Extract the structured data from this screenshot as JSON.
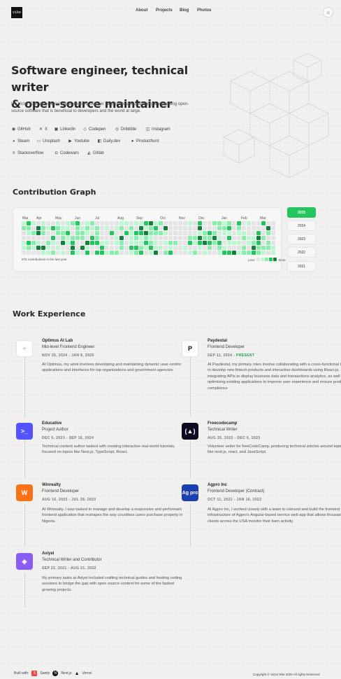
{
  "header": {
    "logo_text": "vike",
    "nav": [
      {
        "label": "About"
      },
      {
        "label": "Projects"
      },
      {
        "label": "Blog"
      },
      {
        "label": "Photos"
      }
    ],
    "theme_icon": "sun-icon"
  },
  "hero": {
    "title_line1": "Software engineer, technical writer",
    "title_line2": "& open-source maintainer",
    "intro": "I'm Victor Eke, an experienced frontend developer passionate about learning and building open-source software that is beneficial to developers and the world at large.",
    "socials": [
      {
        "label": "GitHub",
        "icon": "github-icon"
      },
      {
        "label": "X",
        "icon": "x-icon"
      },
      {
        "label": "Linkedin",
        "icon": "linkedin-icon"
      },
      {
        "label": "Codepen",
        "icon": "codepen-icon"
      },
      {
        "label": "Dribbble",
        "icon": "dribbble-icon"
      },
      {
        "label": "Instagram",
        "icon": "instagram-icon"
      },
      {
        "label": "Steam",
        "icon": "steam-icon"
      },
      {
        "label": "Unsplash",
        "icon": "unsplash-icon"
      },
      {
        "label": "Youtube",
        "icon": "youtube-icon"
      },
      {
        "label": "Daily.dev",
        "icon": "dailydev-icon"
      },
      {
        "label": "Producthunt",
        "icon": "producthunt-icon"
      },
      {
        "label": "Stackoverflow",
        "icon": "stackoverflow-icon"
      },
      {
        "label": "Codewars",
        "icon": "codewars-icon"
      },
      {
        "label": "Gitlab",
        "icon": "gitlab-icon"
      }
    ]
  },
  "contribution": {
    "title": "Contribution Graph",
    "months": [
      "Mar",
      "Apr",
      "May",
      "Jun",
      "Jul",
      "Aug",
      "Sep",
      "Oct",
      "Nov",
      "Dec",
      "Jan",
      "Feb",
      "Mar"
    ],
    "summary": "875 contributions in the last year",
    "legend_less": "Less",
    "legend_more": "More",
    "colors": [
      "#e4e4e7",
      "#bbf7d0",
      "#86efac",
      "#22c55e",
      "#15803d"
    ],
    "years": [
      {
        "label": "2025",
        "active": true
      },
      {
        "label": "2024",
        "active": false
      },
      {
        "label": "2023",
        "active": false
      },
      {
        "label": "2022",
        "active": false
      },
      {
        "label": "2021",
        "active": false
      }
    ]
  },
  "experience": {
    "title": "Work Experience",
    "jobs": [
      {
        "company": "Optimus AI Lab",
        "role": "Mid-level Frontend Engineer",
        "start": "NOV 25, 2024",
        "end": "JAN 8, 2025",
        "present": false,
        "desc": "At Optimus, my work involves developing and maintaining dynamic user-centric applications and interfaces for top organizations and government agencies",
        "logo_icon": "optimus-logo-icon",
        "logo_text": "✦",
        "logo_bg": "#ffffff",
        "logo_fg": "#d4d4d8"
      },
      {
        "company": "Paydestal",
        "role": "Frontend Developer",
        "start": "SEP 11, 2024",
        "end": "PRESENT",
        "present": true,
        "desc": "At Paydestal, my primary roles involve collaborating with a cross-functional team to develop new fintech products and interactive dashboards using React.js, integrating APIs to display business data and transactions analytics, as well as optimizing existing applications to improve user experience and ensure product compliance",
        "logo_icon": "paydestal-logo-icon",
        "logo_text": "P",
        "logo_bg": "#ffffff",
        "logo_fg": "#111111"
      },
      {
        "company": "Educative",
        "role": "Project Author",
        "start": "DEC 5, 2023",
        "end": "SEP 16, 2024",
        "present": false,
        "desc": "Technical content author tasked with creating interactive real-world tutorials, focused on topics like Next.js, TypeScript, React.",
        "logo_icon": "educative-logo-icon",
        "logo_text": ">_",
        "logo_bg": "#5553ff",
        "logo_fg": "#ffffff"
      },
      {
        "company": "Freecodecamp",
        "role": "Technical Writer",
        "start": "AUG 25, 2022",
        "end": "DEC 6, 2023",
        "present": false,
        "desc": "Volunteer writer for freeCodeCamp, producing technical articles around topics like next.js, react, and JavaScript.",
        "logo_icon": "freecodecamp-logo-icon",
        "logo_text": "(▲)",
        "logo_bg": "#0a0a23",
        "logo_fg": "#ffffff"
      },
      {
        "company": "Winrealty",
        "role": "Frontend Developer",
        "start": "AUG 16, 2022",
        "end": "JUL 28, 2023",
        "present": false,
        "desc": "At Winrealty, I was tasked to manage and develop a responsive and performant frontend application that reshapes the way countless users purchase property in Nigeria.",
        "logo_icon": "winrealty-logo-icon",
        "logo_text": "W",
        "logo_bg": "#f97316",
        "logo_fg": "#ffffff"
      },
      {
        "company": "Agpro Inc",
        "role": "Frontend Developer (Contract)",
        "start": "OCT 11, 2022",
        "end": "JAN 16, 2023",
        "present": false,
        "desc": "At Agpro Inc, I worked closely with a team to rebrand and build the frontend infrastructure of Agpro's Angular-based service web app that allows thousands of clients across the USA monitor their barn activity.",
        "logo_icon": "agpro-logo-icon",
        "logo_text": "Ag pro",
        "logo_bg": "#1e40af",
        "logo_fg": "#ffffff"
      },
      {
        "company": "Aviyel",
        "role": "Technical Writer and Contributor",
        "start": "SEP 22, 2021",
        "end": "AUG 21, 2022",
        "present": false,
        "desc": "My primary tasks at Aviyel included crafting technical guides and hosting coding sessions to bridge the gap with open source content for some of the fastest growing projects.",
        "logo_icon": "aviyel-logo-icon",
        "logo_text": "◈",
        "logo_bg": "#8b5cf6",
        "logo_fg": "#ffffff"
      }
    ]
  },
  "footer": {
    "built_with": "Built with:",
    "tools": [
      {
        "label": "Sanity",
        "icon": "sanity-icon"
      },
      {
        "label": "Next.js",
        "icon": "nextjs-icon"
      },
      {
        "label": "Vercel",
        "icon": "vercel-icon"
      }
    ],
    "copyright": "Copyright © Victor Eke 2025 All rights Reserved"
  }
}
